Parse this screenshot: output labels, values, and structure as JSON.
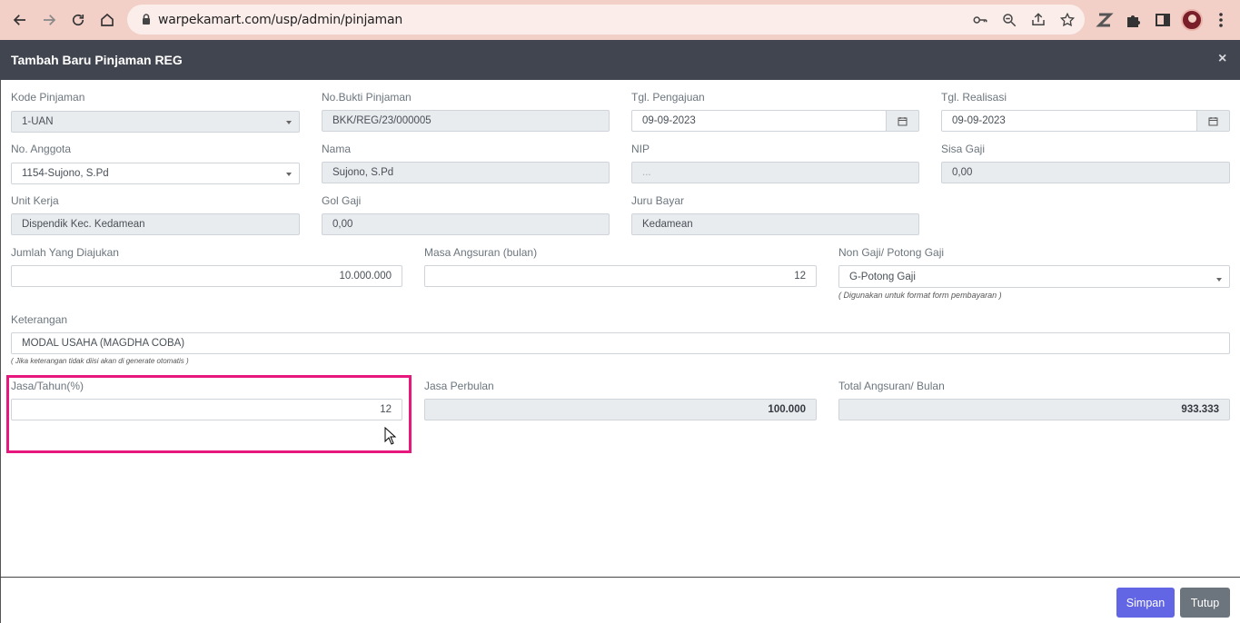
{
  "browser": {
    "url": "warpekamart.com/usp/admin/pinjaman"
  },
  "modal": {
    "title": "Tambah Baru Pinjaman REG",
    "close": "×"
  },
  "form": {
    "kode_pinjaman": {
      "label": "Kode Pinjaman",
      "value": "1-UAN"
    },
    "no_bukti": {
      "label": "No.Bukti Pinjaman",
      "value": "BKK/REG/23/000005"
    },
    "tgl_pengajuan": {
      "label": "Tgl. Pengajuan",
      "value": "09-09-2023"
    },
    "tgl_realisasi": {
      "label": "Tgl. Realisasi",
      "value": "09-09-2023"
    },
    "no_anggota": {
      "label": "No. Anggota",
      "value": "1154-Sujono, S.Pd"
    },
    "nama": {
      "label": "Nama",
      "value": "Sujono, S.Pd"
    },
    "nip": {
      "label": "NIP",
      "value": "..."
    },
    "sisa_gaji": {
      "label": "Sisa Gaji",
      "value": "0,00"
    },
    "unit_kerja": {
      "label": "Unit Kerja",
      "value": "Dispendik Kec. Kedamean"
    },
    "gol_gaji": {
      "label": "Gol Gaji",
      "value": "0,00"
    },
    "juru_bayar": {
      "label": "Juru Bayar",
      "value": "Kedamean"
    },
    "jumlah": {
      "label": "Jumlah Yang Diajukan",
      "value": "10.000.000"
    },
    "masa_angsuran": {
      "label": "Masa Angsuran (bulan)",
      "value": "12"
    },
    "non_gaji": {
      "label": "Non Gaji/ Potong Gaji",
      "value": "G-Potong Gaji",
      "hint": "( Digunakan untuk format form pembayaran )"
    },
    "keterangan": {
      "label": "Keterangan",
      "value": "MODAL USAHA (MAGDHA COBA)",
      "hint": "( Jika keterangan tidak diisi akan di generate otomatis )"
    },
    "jasa_tahun": {
      "label": "Jasa/Tahun(%)",
      "value": "12"
    },
    "jasa_perbulan": {
      "label": "Jasa Perbulan",
      "value": "100.000"
    },
    "total_angsuran": {
      "label": "Total Angsuran/ Bulan",
      "value": "933.333"
    }
  },
  "footer": {
    "save_label": "Simpan",
    "close_label": "Tutup"
  },
  "colors": {
    "browser_bar": "#f2cfc7",
    "modal_header": "#41454f",
    "highlight": "#e8177d",
    "save_button": "#6265e4",
    "close_button": "#6c757d"
  }
}
